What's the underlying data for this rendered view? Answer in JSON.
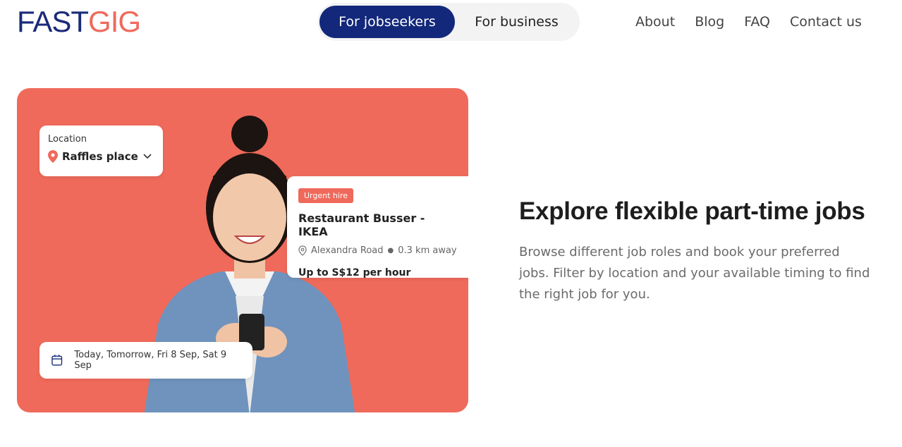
{
  "brand": {
    "part1": "FAST",
    "part2": "GIG"
  },
  "toggle": {
    "jobseekers": "For jobseekers",
    "business": "For business"
  },
  "nav": [
    "About",
    "Blog",
    "FAQ",
    "Contact us"
  ],
  "hero": {
    "location_card": {
      "label": "Location",
      "value": "Raffles place"
    },
    "job_card": {
      "badge": "Urgent hire",
      "title": "Restaurant Busser - IKEA",
      "location": "Alexandra Road",
      "distance": "0.3 km away",
      "pay": "Up to S$12 per hour"
    },
    "date_card": {
      "dates": "Today, Tomorrow, Fri 8 Sep, Sat 9 Sep"
    }
  },
  "content": {
    "headline": "Explore flexible part-time jobs",
    "description": "Browse different job roles and book your preferred jobs. Filter by location and your available timing to find the right job for you."
  },
  "colors": {
    "brand_navy": "#13287a",
    "brand_coral": "#ef6a5b"
  }
}
